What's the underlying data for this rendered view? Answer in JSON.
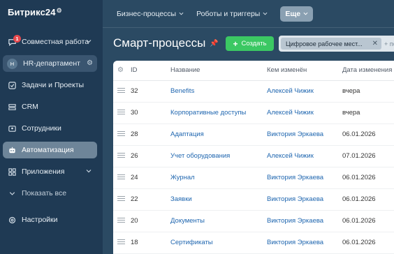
{
  "sidebar": {
    "logo": "Битрикс24",
    "items": [
      {
        "label": "Совместная работа",
        "badge": "1"
      },
      {
        "label": "HR-департамент",
        "avatar": "H"
      },
      {
        "label": "Задачи и Проекты"
      },
      {
        "label": "CRM"
      },
      {
        "label": "Сотрудники"
      },
      {
        "label": "Автоматизация"
      },
      {
        "label": "Приложения"
      },
      {
        "label": "Показать все"
      },
      {
        "label": "Настройки"
      }
    ]
  },
  "topbar": {
    "items": [
      {
        "label": "Бизнес-процессы"
      },
      {
        "label": "Роботы и триггеры"
      },
      {
        "label": "Еще"
      }
    ]
  },
  "page": {
    "title": "Смарт-процессы",
    "create_label": "Создать",
    "filter_chip": "Цифровое рабочее мест...",
    "filter_extra": "+ по"
  },
  "table": {
    "columns": [
      "ID",
      "Название",
      "Кем изменён",
      "Дата изменения"
    ],
    "rows": [
      {
        "id": "32",
        "name": "Benefits",
        "author": "Алексей Чижик",
        "date": "вчера"
      },
      {
        "id": "30",
        "name": "Корпоративные доступы",
        "author": "Алексей Чижик",
        "date": "вчера"
      },
      {
        "id": "28",
        "name": "Адаптация",
        "author": "Виктория Эркаева",
        "date": "06.01.2026"
      },
      {
        "id": "26",
        "name": "Учет оборудования",
        "author": "Алексей Чижик",
        "date": "07.01.2026"
      },
      {
        "id": "24",
        "name": "Журнал",
        "author": "Виктория Эркаева",
        "date": "06.01.2026"
      },
      {
        "id": "22",
        "name": "Заявки",
        "author": "Виктория Эркаева",
        "date": "06.01.2026"
      },
      {
        "id": "20",
        "name": "Документы",
        "author": "Виктория Эркаева",
        "date": "06.01.2026"
      },
      {
        "id": "18",
        "name": "Сертификаты",
        "author": "Виктория Эркаева",
        "date": "06.01.2026"
      }
    ]
  },
  "colors": {
    "sidebar_bg": "#1f3a54",
    "content_bg": "#2b4a63",
    "create_green": "#3bc863",
    "link_blue": "#2067b0",
    "badge_red": "#e5484d"
  }
}
